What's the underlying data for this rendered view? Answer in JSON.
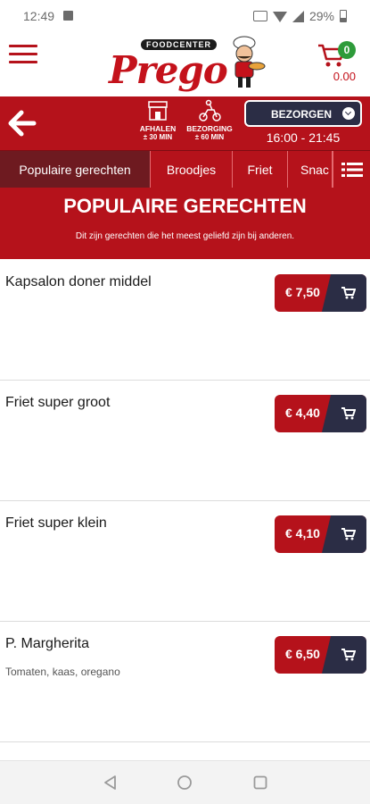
{
  "status_bar": {
    "time": "12:49",
    "battery": "29%"
  },
  "header": {
    "logo_text": "Prego",
    "logo_subtitle": "FOODCENTER",
    "cart_count": "0",
    "cart_total": "0.00"
  },
  "order_bar": {
    "pickup_label": "AFHALEN",
    "pickup_eta": "± 30 MIN",
    "delivery_label": "BEZORGING",
    "delivery_eta": "± 60 MIN",
    "mode_select": "BEZORGEN",
    "hours": "16:00 - 21:45"
  },
  "tabs": [
    "Populaire gerechten",
    "Broodjes",
    "Friet",
    "Snac"
  ],
  "section": {
    "title": "POPULAIRE GERECHTEN",
    "subtitle": "Dit zijn gerechten die het meest geliefd zijn bij anderen."
  },
  "items": [
    {
      "name": "Kapsalon doner middel",
      "desc": "",
      "price": "€ 7,50"
    },
    {
      "name": "Friet super groot",
      "desc": "",
      "price": "€ 4,40"
    },
    {
      "name": "Friet super klein",
      "desc": "",
      "price": "€ 4,10"
    },
    {
      "name": "P. Margherita",
      "desc": "Tomaten, kaas, oregano",
      "price": "€ 6,50"
    }
  ],
  "colors": {
    "brand_red": "#b5121b",
    "dark_navy": "#2b2d45",
    "badge_green": "#2e9b3a"
  }
}
